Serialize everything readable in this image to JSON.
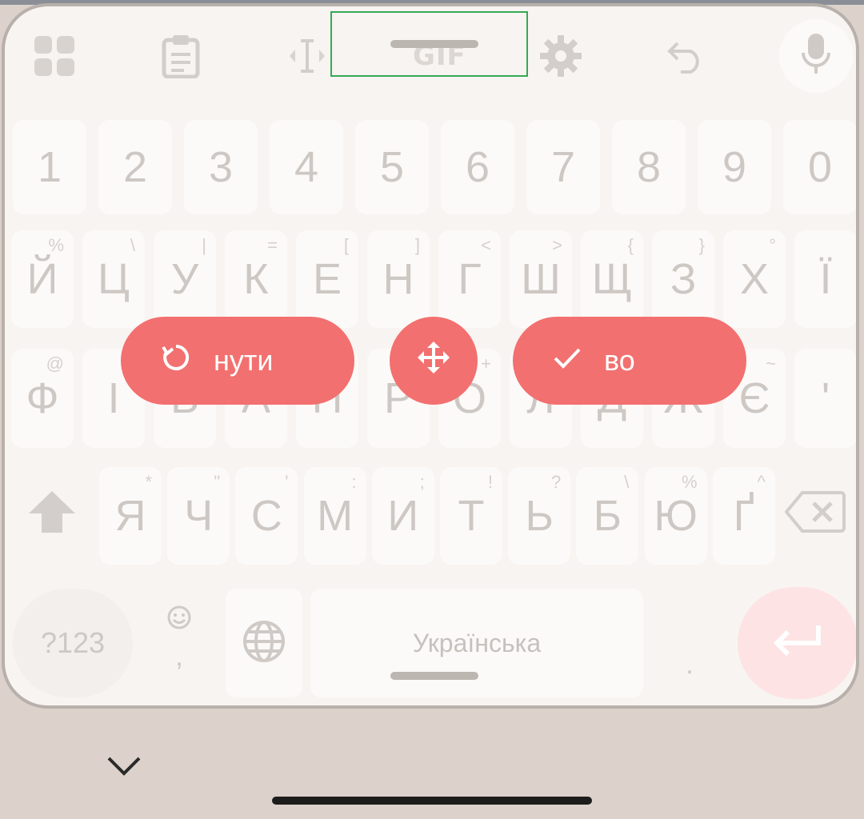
{
  "toolbar": {
    "apps_icon": "apps-grid-icon",
    "clipboard_icon": "clipboard-icon",
    "cursor_icon": "text-cursor-icon",
    "gif_label": "GIF",
    "settings_icon": "gear-icon",
    "undo_icon": "undo-icon",
    "mic_icon": "microphone-icon"
  },
  "rows": {
    "numbers": [
      "1",
      "2",
      "3",
      "4",
      "5",
      "6",
      "7",
      "8",
      "9",
      "0"
    ],
    "row1": [
      {
        "key": "Й",
        "alt": "%"
      },
      {
        "key": "Ц",
        "alt": "\\"
      },
      {
        "key": "У",
        "alt": "|"
      },
      {
        "key": "К",
        "alt": "="
      },
      {
        "key": "Е",
        "alt": "["
      },
      {
        "key": "Н",
        "alt": "]"
      },
      {
        "key": "Г",
        "alt": "<"
      },
      {
        "key": "Ш",
        "alt": ">"
      },
      {
        "key": "Щ",
        "alt": "{"
      },
      {
        "key": "З",
        "alt": "}"
      },
      {
        "key": "Х",
        "alt": "°"
      },
      {
        "key": "Ї",
        "alt": ""
      }
    ],
    "row2": [
      {
        "key": "Ф",
        "alt": "@"
      },
      {
        "key": "І",
        "alt": ""
      },
      {
        "key": "В",
        "alt": ""
      },
      {
        "key": "А",
        "alt": ""
      },
      {
        "key": "П",
        "alt": ""
      },
      {
        "key": "Р",
        "alt": ""
      },
      {
        "key": "О",
        "alt": "+"
      },
      {
        "key": "Л",
        "alt": ""
      },
      {
        "key": "Д",
        "alt": ""
      },
      {
        "key": "Ж",
        "alt": ""
      },
      {
        "key": "Є",
        "alt": "~"
      },
      {
        "key": "'",
        "alt": ""
      }
    ],
    "row3": [
      {
        "key": "Я",
        "alt": "*"
      },
      {
        "key": "Ч",
        "alt": "\""
      },
      {
        "key": "С",
        "alt": "'"
      },
      {
        "key": "М",
        "alt": ":"
      },
      {
        "key": "И",
        "alt": ";"
      },
      {
        "key": "Т",
        "alt": "!"
      },
      {
        "key": "Ь",
        "alt": "?"
      },
      {
        "key": "Б",
        "alt": "\\"
      },
      {
        "key": "Ю",
        "alt": "%"
      },
      {
        "key": "Ґ",
        "alt": "^"
      }
    ]
  },
  "bottom": {
    "symbols_label": "?123",
    "comma_label": ",",
    "emoji_icon": "emoji-icon",
    "globe_icon": "globe-icon",
    "space_label": "Українська",
    "period_label": ".",
    "enter_icon": "enter-icon",
    "shift_icon": "shift-icon",
    "backspace_icon": "backspace-icon"
  },
  "resize_controls": {
    "reset_label": "нути",
    "move_icon": "move-arrows-icon",
    "done_label": "во"
  },
  "nav": {
    "hide_keyboard_icon": "chevron-down-icon"
  },
  "colors": {
    "accent": "#f2706f",
    "enter_bg": "#fde3e3",
    "nav_bg": "#dcd1cb"
  }
}
